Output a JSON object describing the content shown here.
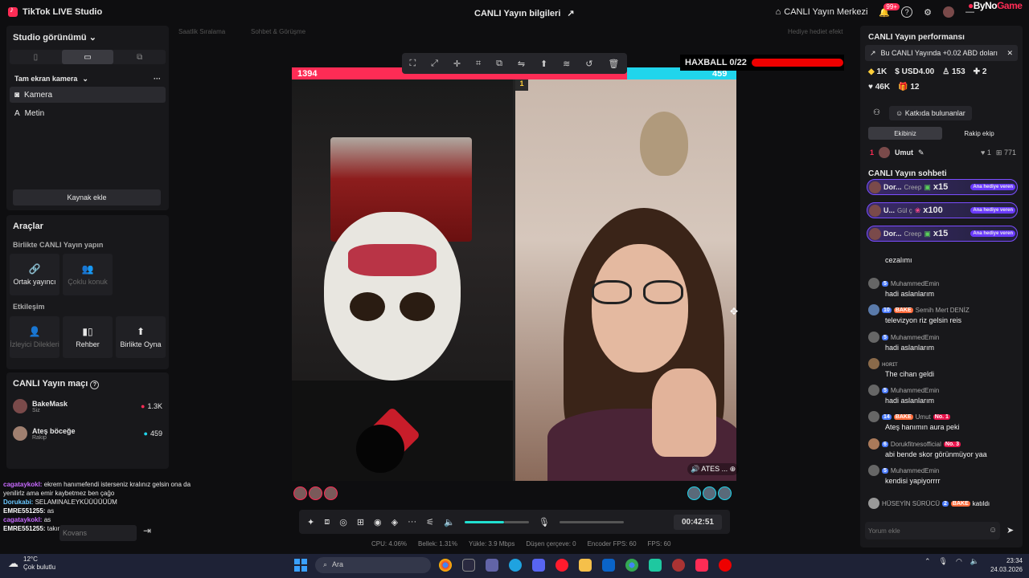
{
  "app": {
    "title": "TikTok LIVE Studio",
    "center_title": "CANLI Yayın bilgileri",
    "live_center": "CANLI Yayın Merkezi",
    "notif_count": "99+",
    "watermark_a": "ByNo",
    "watermark_b": "Game"
  },
  "hints": {
    "hourly": "Saatlik Sıralama",
    "chat_meet": "Sohbet & Görüşme",
    "gift_effects": "Hediye hediet efekt"
  },
  "studio": {
    "title": "Studio görünümü",
    "section": "Tam ekran kamera",
    "items": [
      {
        "label": "Kamera",
        "icon": "camera-icon"
      },
      {
        "label": "Metin",
        "icon": "text-icon"
      }
    ],
    "add_source": "Kaynak ekle"
  },
  "tools": {
    "title": "Araçlar",
    "group1": "Birlikte CANLI Yayın yapın",
    "group1_items": [
      {
        "label": "Ortak yayıncı",
        "icon": "link-icon",
        "enabled": true
      },
      {
        "label": "Çoklu konuk",
        "icon": "users-icon",
        "enabled": false
      }
    ],
    "group2": "Etkileşim",
    "group2_items": [
      {
        "label": "İzleyici Dilekleri",
        "icon": "wishlist-icon",
        "enabled": false
      },
      {
        "label": "Rehber",
        "icon": "guide-icon",
        "enabled": true
      },
      {
        "label": "Birlikte Oyna",
        "icon": "play-together-icon",
        "enabled": true
      }
    ]
  },
  "match": {
    "title": "CANLI Yayın maçı",
    "players": [
      {
        "name": "BakeMask",
        "role": "Siz",
        "score": "1.3K"
      },
      {
        "name": "Ateş böceğe",
        "role": "Rakip",
        "score": "459"
      }
    ]
  },
  "overlay_chat": [
    {
      "user": "cagataykokl:",
      "text": "ekrem hanımefendi isterseniz kralınız gelsin ona da yenilirlz ama emir kaybetmez ben çağo",
      "style": "u1"
    },
    {
      "user": "Dorukabi:",
      "text": "SELAMINALEYKÜÜÜÜÜÜM",
      "style": "u2"
    },
    {
      "user": "EMRE551255:",
      "text": "as",
      "style": "u3"
    },
    {
      "user": "cagataykokl:",
      "text": "as",
      "style": "u1"
    },
    {
      "user": "EMRE551255:",
      "text": "takım elbise rizz",
      "style": "u3"
    }
  ],
  "kovans_placeholder": "Kovans",
  "stage": {
    "score_left": "1394",
    "score_right": "459",
    "rank": "1",
    "haxball": "HAXBALL 0/22",
    "haxball_progress": 1.0,
    "name_tag": "ATES ..."
  },
  "control": {
    "timer": "00:42:51",
    "volume": 0.62
  },
  "stats": [
    "CPU: 4.06%",
    "Bellek: 1.31%",
    "Yükle: 3.9 Mbps",
    "Düşen çerçeve: 0",
    "Encoder FPS: 60",
    "FPS: 60"
  ],
  "perf": {
    "title": "CANLI Yayın performansı",
    "banner": "Bu CANLI Yayında +0.02 ABD doları",
    "stats_row1": [
      {
        "icon": "diamond-icon",
        "value": "1K"
      },
      {
        "icon": "dollar-icon",
        "value": "USD4.00"
      },
      {
        "icon": "viewers-icon",
        "value": "153"
      },
      {
        "icon": "user-plus-icon",
        "value": "2"
      }
    ],
    "stats_row2": [
      {
        "icon": "heart-icon",
        "value": "46K"
      },
      {
        "icon": "gift-icon",
        "value": "12"
      }
    ],
    "contributors_btn": "Katkıda bulunanlar",
    "tabs": [
      "Ekibiniz",
      "Rakip ekip"
    ],
    "top": {
      "rank": "1",
      "name": "Umut",
      "likes": "1",
      "score": "771"
    }
  },
  "chat": {
    "title": "CANLI Yayın sohbeti",
    "gift_tag": "Ana hediye veren",
    "gifts": [
      {
        "name": "Dor...",
        "gift": "Creep",
        "count": "x15"
      },
      {
        "name": "U...",
        "gift": "Gül ç",
        "count": "x100"
      },
      {
        "name": "Dor...",
        "gift": "Creep",
        "count": "x15"
      }
    ],
    "messages": [
      {
        "user": "",
        "level": "",
        "fan": "",
        "rank": "",
        "text": "cezalımı"
      },
      {
        "user": "MuhammedEmin",
        "level": "5",
        "fan": "",
        "rank": "",
        "text": "hadi aslanlarım"
      },
      {
        "user": "Semih Mert DENİZ",
        "level": "10",
        "fan": "BAKE",
        "rank": "",
        "text": "televizyon riz gelsin reis"
      },
      {
        "user": "MuhammedEmin",
        "level": "5",
        "fan": "",
        "rank": "",
        "text": "hadi aslanlarım"
      },
      {
        "user": "ʜᴏʀɪᴛ",
        "level": "",
        "fan": "",
        "rank": "",
        "text": "The cihan geldi"
      },
      {
        "user": "MuhammedEmin",
        "level": "5",
        "fan": "",
        "rank": "",
        "text": "hadi aslanlarım"
      },
      {
        "user": "Umut",
        "level": "14",
        "fan": "BAKE",
        "rank": "No. 1",
        "text": "Ateş hanımın aura peki"
      },
      {
        "user": "Dorukfitnesofficial",
        "level": "6",
        "fan": "",
        "rank": "No. 3",
        "text": "abi bende skor görünmüyor yaa"
      },
      {
        "user": "MuhammedEmin",
        "level": "5",
        "fan": "",
        "rank": "",
        "text": "kendisi yapiyorrrr"
      }
    ],
    "join": {
      "user": "HÜSEYİN SÜRÜCÜ",
      "level": "2",
      "fan": "BAKE",
      "text": "katıldı"
    },
    "input_placeholder": "Yorum ekle"
  },
  "taskbar": {
    "temp": "12°C",
    "weather": "Çok bulutlu",
    "search": "Ara",
    "time": "23:34",
    "date": "24.03.2026"
  }
}
